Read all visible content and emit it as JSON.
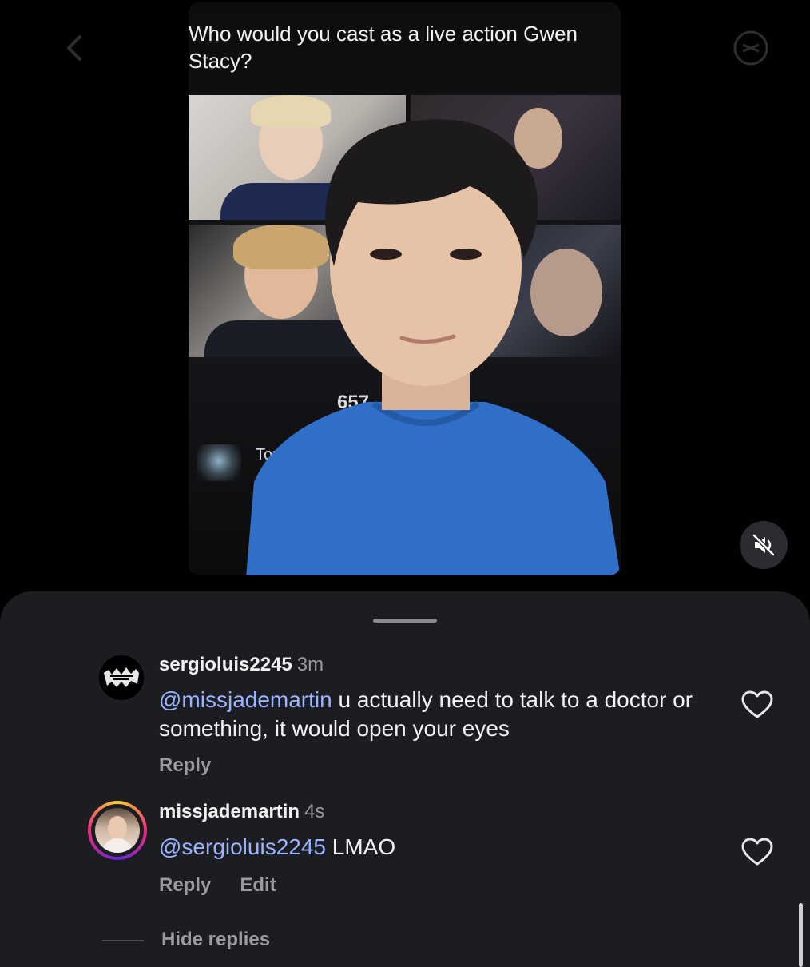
{
  "video": {
    "question": "Who would you cast as a live action Gwen Stacy?",
    "views": "657",
    "topic_label": "Top"
  },
  "comments": [
    {
      "username": "sergioluis2245",
      "time": "3m",
      "mention": "@missjademartin",
      "text": " u actually need to talk to a doctor or something, it would open your eyes",
      "actions": [
        "Reply"
      ]
    },
    {
      "username": "missjademartin",
      "time": "4s",
      "mention": "@sergioluis2245",
      "text": " LMAO",
      "actions": [
        "Reply",
        "Edit"
      ]
    }
  ],
  "hide_replies_label": "Hide replies",
  "colors": {
    "sheet_bg": "#1c1d21",
    "mention": "#9ab4ff",
    "muted_text": "#9a9ba0"
  },
  "icons": {
    "back": "chevron-left-icon",
    "share": "share-icon",
    "mute": "speaker-muted-icon",
    "like": "heart-outline-icon"
  }
}
